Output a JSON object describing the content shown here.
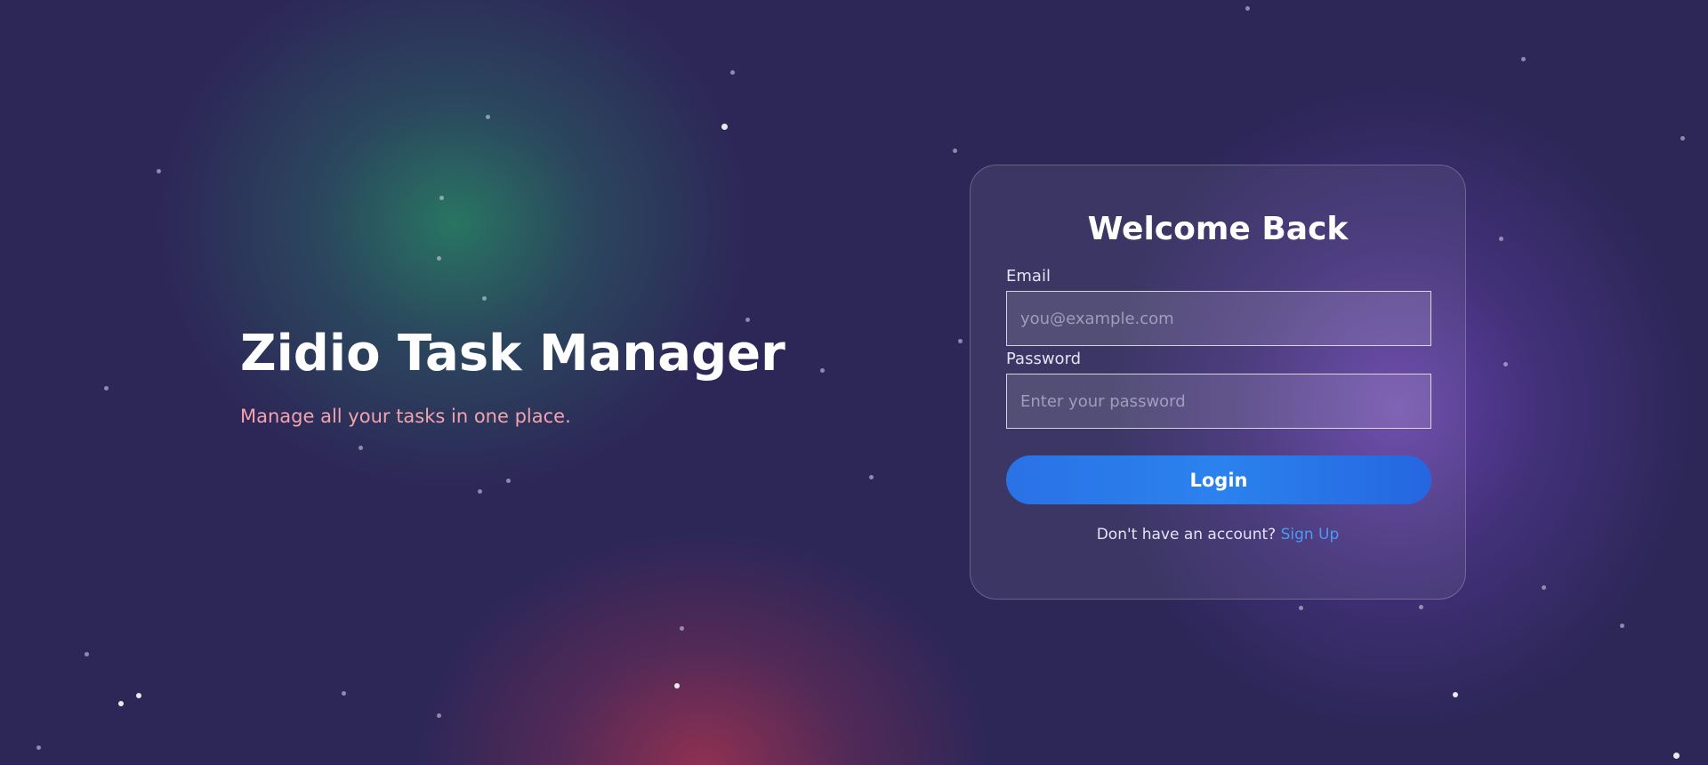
{
  "hero": {
    "title": "Zidio Task Manager",
    "subtitle": "Manage all your tasks in one place."
  },
  "login_card": {
    "title": "Welcome Back",
    "email_label": "Email",
    "email_placeholder": "you@example.com",
    "email_value": "",
    "password_label": "Password",
    "password_placeholder": "Enter your password",
    "password_value": "",
    "login_button": "Login",
    "signup_prompt": "Don't have an account?",
    "signup_link": "Sign Up"
  },
  "colors": {
    "background": "#2d2758",
    "subtitle": "#f2a3ad",
    "button": "#2b7bea",
    "link": "#4b9af5"
  }
}
